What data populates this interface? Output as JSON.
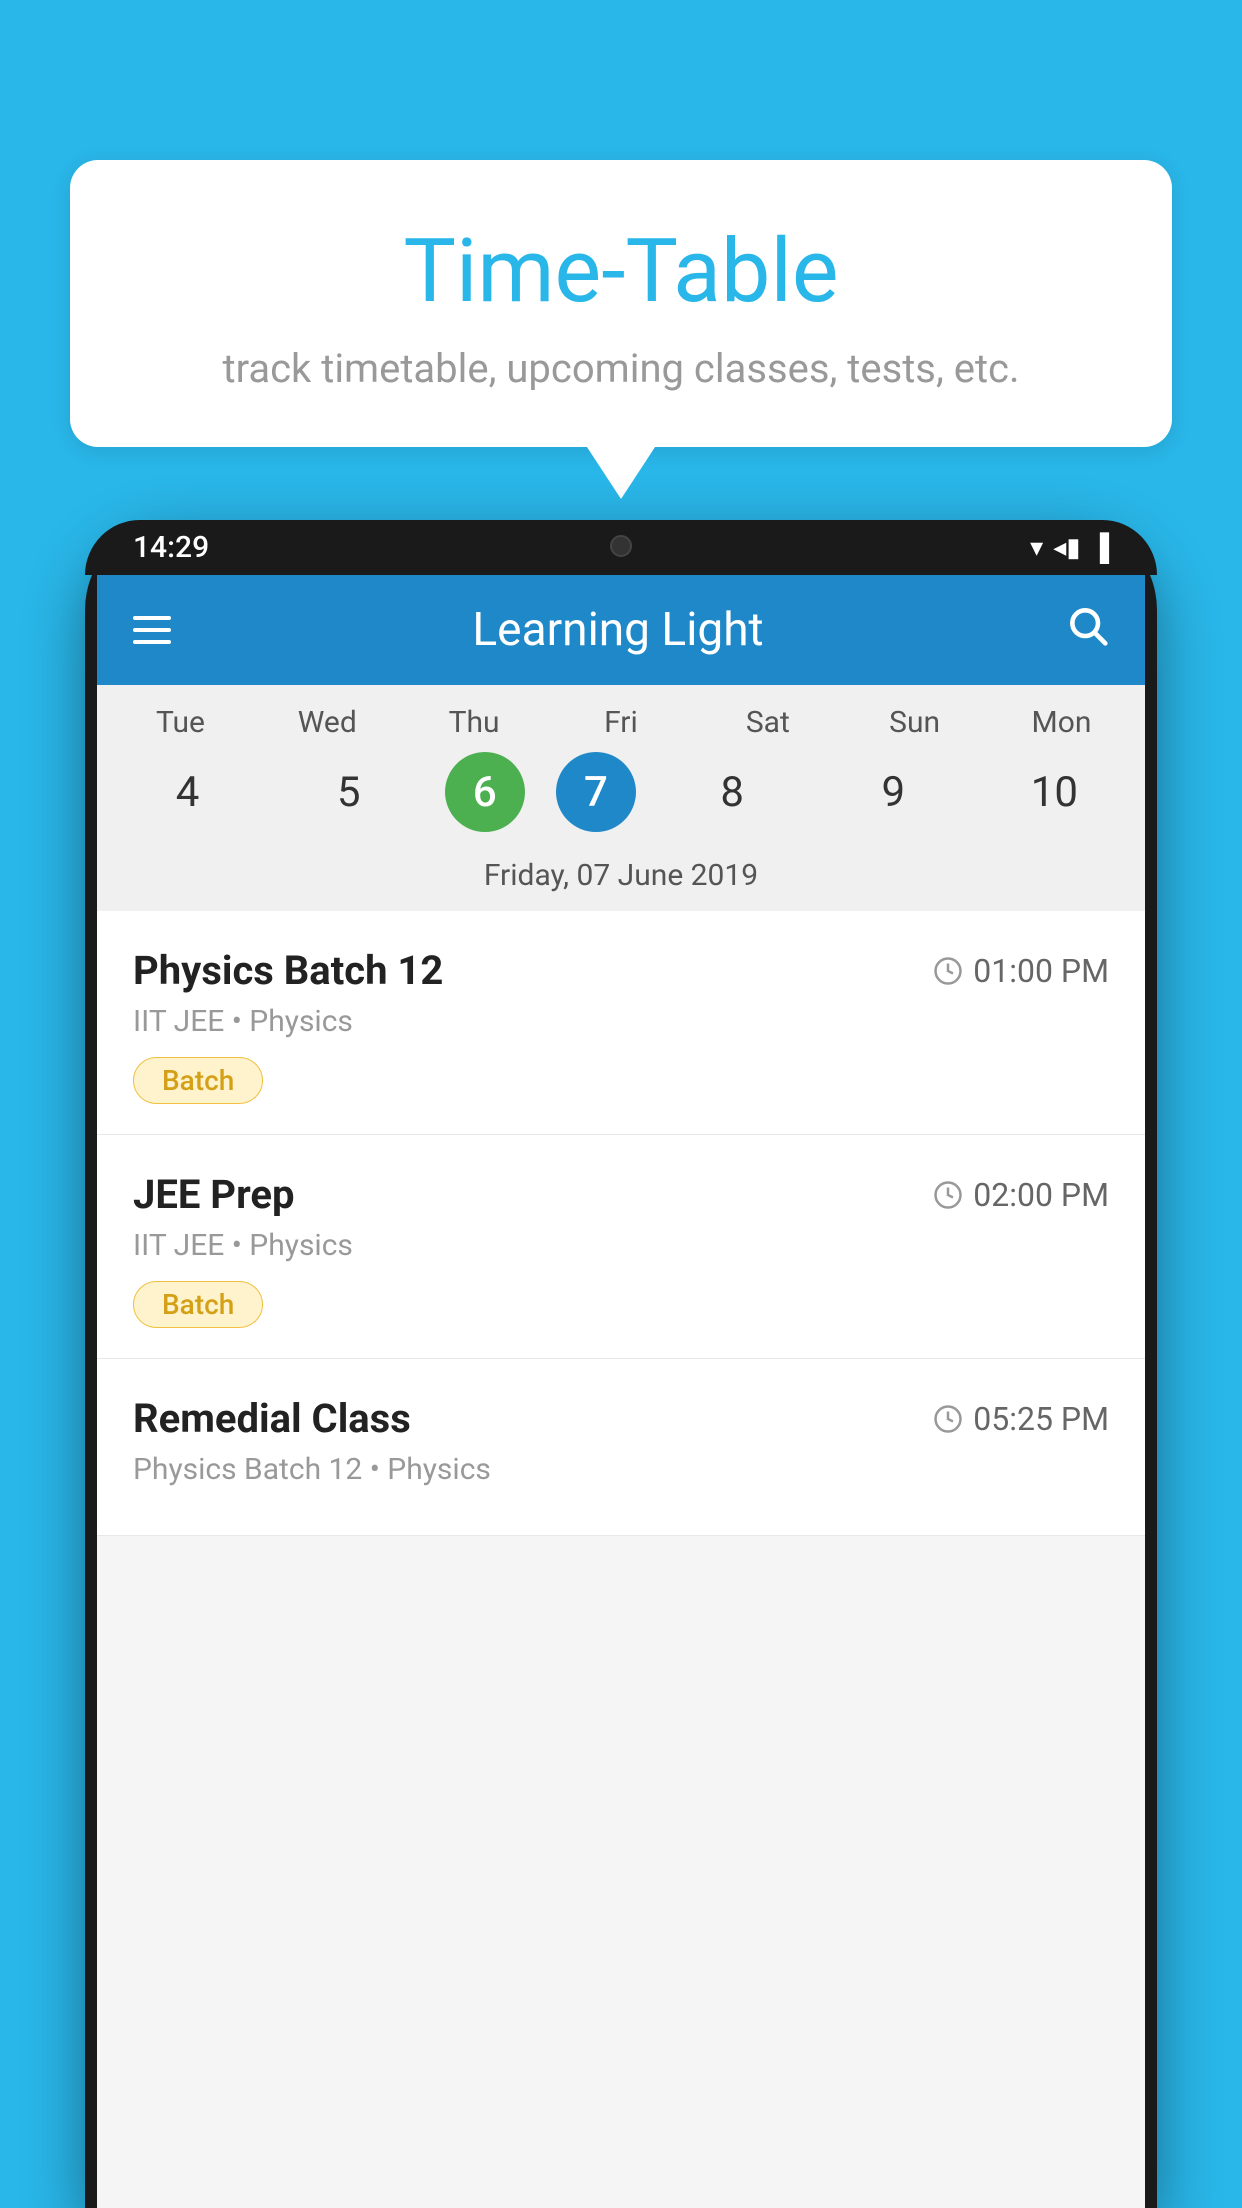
{
  "background_color": "#29B6E8",
  "bubble": {
    "title": "Time-Table",
    "subtitle": "track timetable, upcoming classes, tests, etc."
  },
  "phone": {
    "status_bar": {
      "time": "14:29",
      "signal": "▼◀▐"
    },
    "app_bar": {
      "title": "Learning Light",
      "menu_icon": "menu-icon",
      "search_icon": "search-icon"
    },
    "calendar": {
      "days": [
        {
          "name": "Tue",
          "num": "4",
          "state": "normal"
        },
        {
          "name": "Wed",
          "num": "5",
          "state": "normal"
        },
        {
          "name": "Thu",
          "num": "6",
          "state": "today"
        },
        {
          "name": "Fri",
          "num": "7",
          "state": "selected"
        },
        {
          "name": "Sat",
          "num": "8",
          "state": "normal"
        },
        {
          "name": "Sun",
          "num": "9",
          "state": "normal"
        },
        {
          "name": "Mon",
          "num": "10",
          "state": "normal"
        }
      ],
      "selected_date_label": "Friday, 07 June 2019"
    },
    "schedule": [
      {
        "title": "Physics Batch 12",
        "time": "01:00 PM",
        "meta": "IIT JEE • Physics",
        "badge": "Batch"
      },
      {
        "title": "JEE Prep",
        "time": "02:00 PM",
        "meta": "IIT JEE • Physics",
        "badge": "Batch"
      },
      {
        "title": "Remedial Class",
        "time": "05:25 PM",
        "meta": "Physics Batch 12 • Physics",
        "badge": ""
      }
    ]
  }
}
